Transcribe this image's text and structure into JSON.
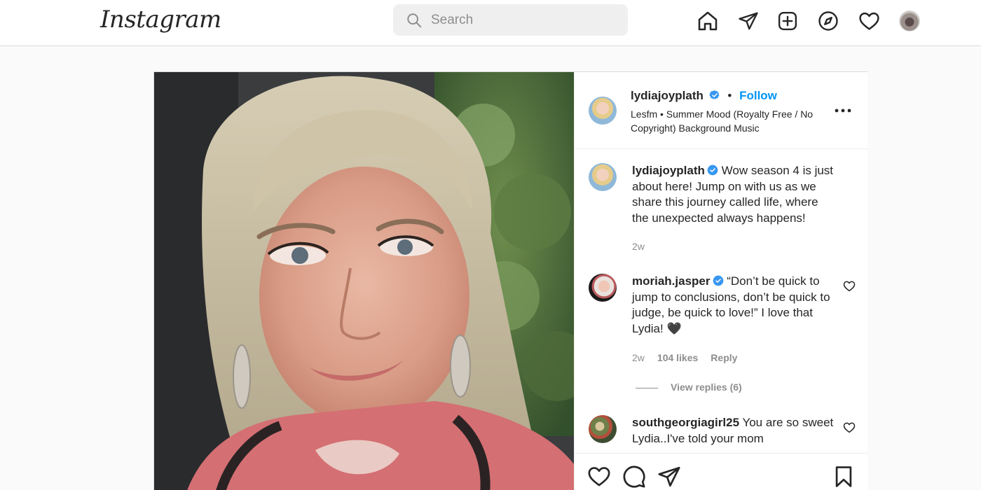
{
  "topbar": {
    "logo": "Instagram",
    "search_placeholder": "Search",
    "icons": [
      "home-icon",
      "direct-message-icon",
      "new-post-icon",
      "explore-icon",
      "activity-heart-icon",
      "profile-avatar"
    ]
  },
  "post": {
    "author": "lydiajoyplath",
    "follow_label": "Follow",
    "separator": "•",
    "music": "Lesfm • Summer Mood (Royalty Free / No Copyright) Background Music",
    "caption": {
      "username": "lydiajoyplath",
      "text": "Wow season 4 is just about here! Jump on with us as we share this journey called life, where the unexpected always happens!",
      "time": "2w"
    },
    "comments": [
      {
        "username": "moriah.jasper",
        "verified": true,
        "text": "“Don’t be quick to jump to conclusions, don’t be quick to judge, be quick to love!” I love that Lydia! 🖤",
        "time": "2w",
        "likes": "104 likes",
        "reply_label": "Reply",
        "view_replies": "View replies (6)"
      },
      {
        "username": "southgeorgiagirl25",
        "verified": false,
        "text": "You are so sweet Lydia..I've told your mom"
      }
    ]
  },
  "colors": {
    "accent": "#0095f6",
    "verified": "#3897f0",
    "muted_text": "#8e8e8e",
    "border": "#dbdbdb"
  }
}
